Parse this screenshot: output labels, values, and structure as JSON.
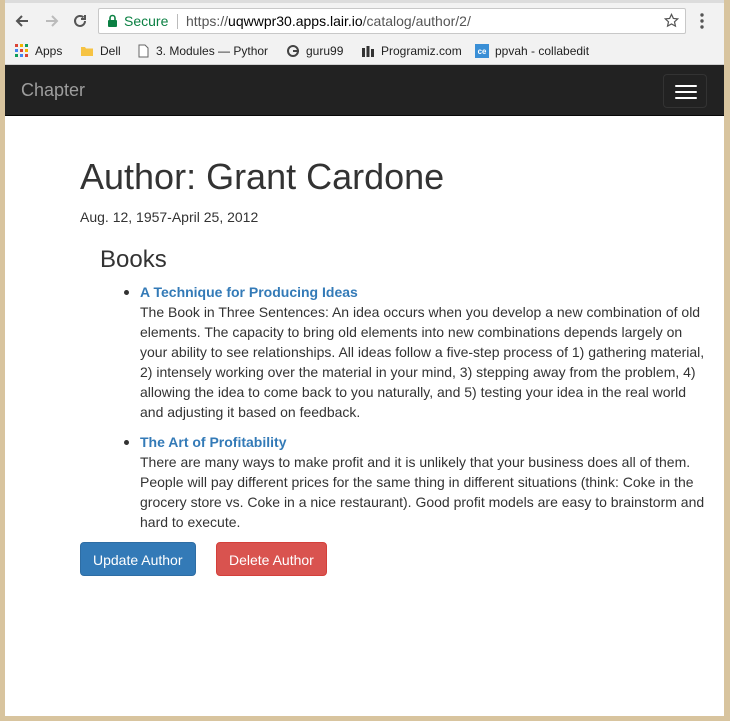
{
  "browser": {
    "secure_label": "Secure",
    "url": {
      "scheme": "https://",
      "host": "uqwwpr30.apps.lair.io",
      "path": "/catalog/author/2/"
    },
    "bookmarks": [
      {
        "label": "Apps",
        "icon": "apps-grid-icon"
      },
      {
        "label": "Dell",
        "icon": "folder-icon"
      },
      {
        "label": "3. Modules — Pythor",
        "icon": "page-icon"
      },
      {
        "label": "guru99",
        "icon": "guru99-icon"
      },
      {
        "label": "Programiz.com",
        "icon": "programiz-icon"
      },
      {
        "label": "ppvah - collabedit",
        "icon": "collabedit-icon"
      }
    ],
    "colors": {
      "secure": "#0b8043"
    }
  },
  "navbar": {
    "brand": "Chapter"
  },
  "author": {
    "heading": "Author: Grant Cardone",
    "dates": "Aug. 12, 1957-April 25, 2012"
  },
  "books": {
    "heading": "Books",
    "items": [
      {
        "title": "A Technique for Producing Ideas",
        "description": "The Book in Three Sentences: An idea occurs when you develop a new combination of old elements. The capacity to bring old elements into new combinations depends largely on your ability to see relationships. All ideas follow a five-step process of 1) gathering material, 2) intensely working over the material in your mind, 3) stepping away from the problem, 4) allowing the idea to come back to you naturally, and 5) testing your idea in the real world and adjusting it based on feedback."
      },
      {
        "title": "The Art of Profitability",
        "description": "There are many ways to make profit and it is unlikely that your business does all of them. People will pay different prices for the same thing in different situations (think: Coke in the grocery store vs. Coke in a nice restaurant). Good profit models are easy to brainstorm and hard to execute."
      }
    ]
  },
  "actions": {
    "update_label": "Update Author",
    "delete_label": "Delete Author"
  },
  "theme": {
    "navbar_bg": "#222222",
    "link": "#337ab7",
    "primary": "#337ab7",
    "danger": "#d9534f"
  }
}
